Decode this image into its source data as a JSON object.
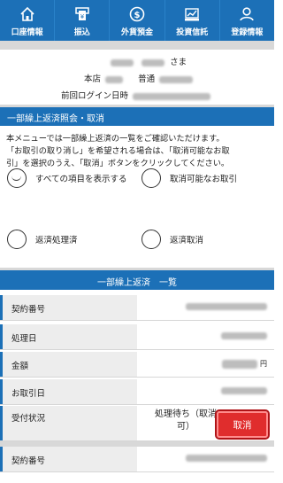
{
  "nav": {
    "items": [
      {
        "label": "口座情報",
        "icon": "house-icon"
      },
      {
        "label": "振込",
        "icon": "transfer-card-icon"
      },
      {
        "label": "外貨預金",
        "icon": "dollar-coin-icon"
      },
      {
        "label": "投資信託",
        "icon": "invest-chart-icon"
      },
      {
        "label": "登録情報",
        "icon": "user-icon"
      }
    ]
  },
  "user": {
    "sama": "さま",
    "branch_label": "本店",
    "account_type": "普通",
    "last_login_label": "前回ログイン日時"
  },
  "section": {
    "title": "一部繰上返済照会・取消",
    "description_line1": "本メニューでは一部繰上返済の一覧をご確認いただけます。",
    "description_line2": "「お取引の取り消し」を希望される場合は、「取消可能なお取",
    "description_line3": "引」を選択のうえ、「取消」ボタンをクリックしてください。"
  },
  "filters": {
    "all": "すべての項目を表示する",
    "cancelable": "取消可能なお取引",
    "processed": "返済処理済",
    "canceled": "返済取消"
  },
  "list": {
    "title": "一部繰上返済　一覧",
    "labels": {
      "contract_no": "契約番号",
      "process_date": "処理日",
      "amount": "金額",
      "trade_date": "お取引日",
      "status": "受付状況"
    },
    "currency": "円",
    "status_value_line1": "処理待ち（取消",
    "status_value_line2": "可）",
    "cancel_button": "取消"
  },
  "colors": {
    "primary": "#1c70b7",
    "cancel": "#e02d2d"
  }
}
